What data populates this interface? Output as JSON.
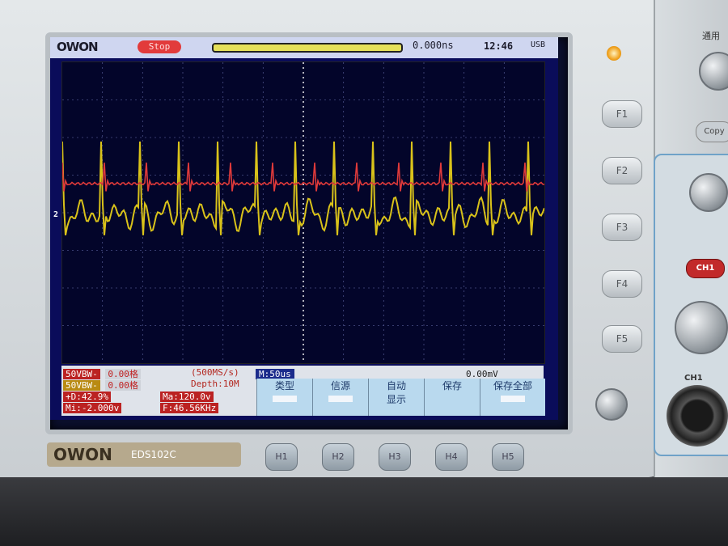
{
  "scope": {
    "brand_logo": "OWON",
    "model": "EDS102C",
    "status": "Stop",
    "trigger_time": "0.000ns",
    "clock": "12:46",
    "usb": "USB",
    "channels": [
      {
        "name": "CH1",
        "coupling": "50VBW-",
        "offset": "0.00格",
        "color": "#e03a3a"
      },
      {
        "name": "CH2",
        "coupling": "50VBW-",
        "offset": "0.00格",
        "color": "#d9c21a"
      }
    ],
    "sample_rate": "(500MS/s)",
    "depth": "Depth:10M",
    "timebase": "M:50us",
    "trigger_level": "0.00mV",
    "measurements": [
      "+D:42.9%",
      "Mi:-2.000v",
      "Ma:120.0v",
      "F:46.56KHz"
    ],
    "menu_items": [
      {
        "label": "类型"
      },
      {
        "label": "信源"
      },
      {
        "label": "自动\n显示"
      },
      {
        "label": "保存"
      },
      {
        "label": "保存全部"
      }
    ],
    "side_keys": [
      "F1",
      "F2",
      "F3",
      "F4",
      "F5"
    ],
    "bottom_keys": [
      "H1",
      "H2",
      "H3",
      "H4",
      "H5"
    ],
    "right_panel": {
      "label_top": "通用",
      "copy": "Copy",
      "ch1_button": "CH1",
      "ch1_label": "CH1"
    }
  }
}
